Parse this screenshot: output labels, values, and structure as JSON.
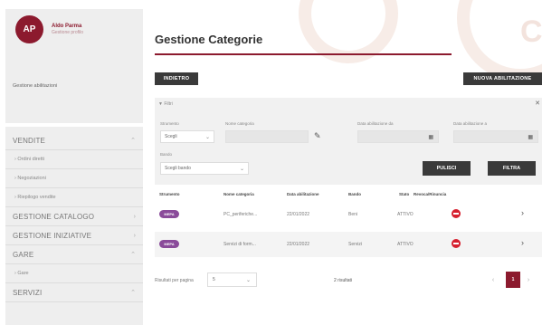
{
  "user": {
    "initials": "AP",
    "name": "Aldo Parma",
    "role": "Gestione profilo"
  },
  "sidebar": {
    "link": "Gestione abilitazioni",
    "items": [
      {
        "label": "VENDITE",
        "type": "section"
      },
      {
        "label": "Ordini diretti",
        "type": "sub"
      },
      {
        "label": "Negoziazioni",
        "type": "sub"
      },
      {
        "label": "Riepilogo vendite",
        "type": "sub"
      },
      {
        "label": "GESTIONE CATALOGO",
        "type": "section"
      },
      {
        "label": "GESTIONE INIZIATIVE",
        "type": "section"
      },
      {
        "label": "GARE",
        "type": "section"
      },
      {
        "label": "Gare",
        "type": "sub"
      },
      {
        "label": "SERVIZI",
        "type": "section"
      }
    ]
  },
  "page": {
    "title": "Gestione Categorie",
    "back_label": "INDIETRO",
    "new_label": "NUOVA ABILITAZIONE"
  },
  "filters": {
    "title": "Filtri",
    "strumento_label": "Strumento",
    "strumento_value": "Scegli",
    "nome_categoria_label": "Nome categoria",
    "data_da_label": "Data abilitazione da",
    "data_a_label": "Data abilitazione a",
    "bando_label": "Bando",
    "bando_value": "Scegli bando",
    "clear_label": "PULISCI",
    "filter_label": "FILTRA"
  },
  "table": {
    "headers": [
      "Strumento",
      "Nome categoria",
      "Data abilitazione",
      "Bando",
      "Stato",
      "Revoca/Rinuncia"
    ],
    "rows": [
      {
        "tag": "MEPA",
        "nome": "PC_periferiche...",
        "data": "22/01/2022",
        "bando": "Beni",
        "stato": "ATTIVO"
      },
      {
        "tag": "MEPA",
        "nome": "Servizi di form...",
        "data": "22/01/2022",
        "bando": "Servizi",
        "stato": "ATTIVO"
      }
    ]
  },
  "footer": {
    "per_page_label": "Risultati per pagina",
    "per_page_value": "5",
    "results_label": "2 risultati",
    "current_page": "1",
    "prev_glyph": "‹",
    "next_glyph": "›"
  }
}
